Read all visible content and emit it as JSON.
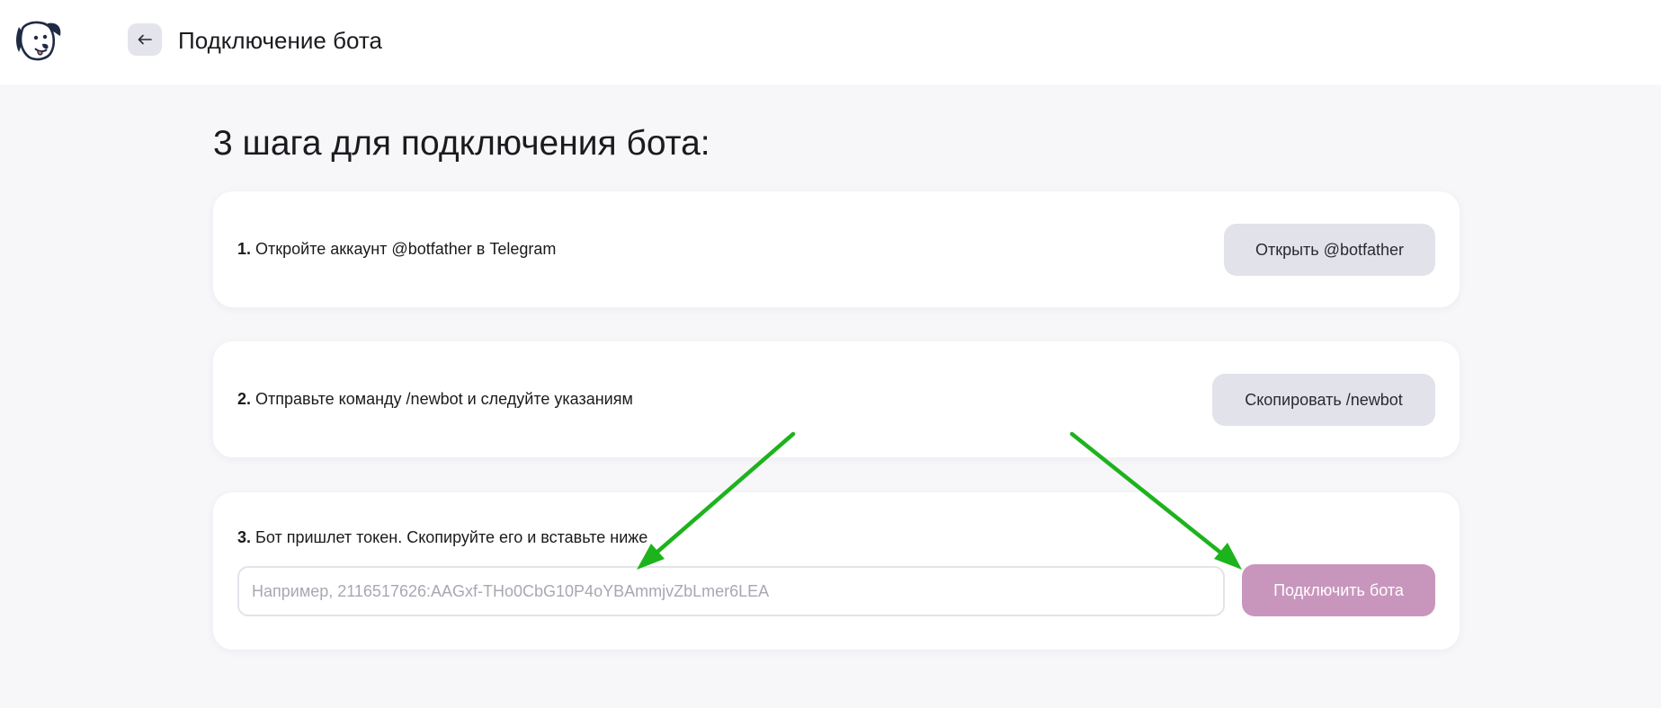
{
  "header": {
    "logo_icon": "dog-mascot-icon",
    "back_icon": "arrow-left-icon",
    "title": "Подключение бота"
  },
  "main": {
    "heading": "3 шага для подключения бота:",
    "steps": [
      {
        "number": "1.",
        "text": "Откройте аккаунт @botfather в Telegram",
        "button_label": "Открыть @botfather"
      },
      {
        "number": "2.",
        "text": "Отправьте команду /newbot и следуйте указаниям",
        "button_label": "Скопировать /newbot"
      },
      {
        "number": "3.",
        "text": "Бот пришлет токен. Скопируйте его и вставьте ниже",
        "input_value": "",
        "input_placeholder": "Например, 2116517626:AAGxf-THo0CbG10P4oYBAmmjvZbLmer6LEA",
        "button_label": "Подключить бота"
      }
    ]
  },
  "annotation": {
    "arrow_color": "#1db31d"
  },
  "colors": {
    "page_background": "#f7f7fa",
    "card_background": "#ffffff",
    "secondary_button": "#e2e2eb",
    "primary_button_disabled": "#c896bc"
  }
}
